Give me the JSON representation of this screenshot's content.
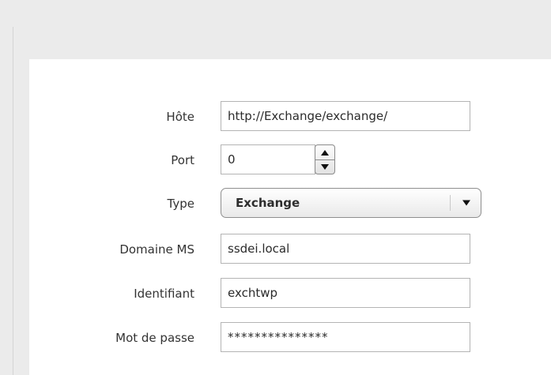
{
  "form": {
    "host": {
      "label": "Hôte",
      "value": "http://Exchange/exchange/"
    },
    "port": {
      "label": "Port",
      "value": "0"
    },
    "type": {
      "label": "Type",
      "value": "Exchange"
    },
    "domain": {
      "label": "Domaine MS",
      "value": "ssdei.local"
    },
    "identifier": {
      "label": "Identifiant",
      "value": "exchtwp"
    },
    "password": {
      "label": "Mot de passe",
      "value": "***************"
    }
  },
  "icons": {
    "spinner_up": "triangle-up-icon",
    "spinner_down": "triangle-down-icon",
    "select_arrow": "chevron-down-icon"
  }
}
